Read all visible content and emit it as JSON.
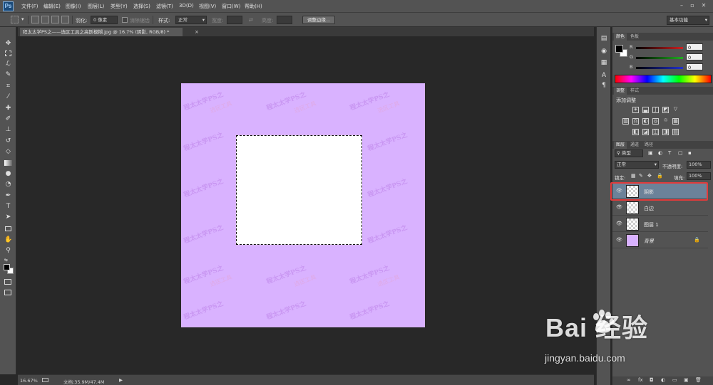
{
  "app": {
    "logo": "Ps"
  },
  "menu": [
    "文件(F)",
    "编辑(E)",
    "图像(I)",
    "图层(L)",
    "类型(Y)",
    "选择(S)",
    "滤镜(T)",
    "3D(D)",
    "视图(V)",
    "窗口(W)",
    "帮助(H)"
  ],
  "options": {
    "feather_label": "羽化:",
    "feather_value": "0 像素",
    "antialias_label": "消除锯齿",
    "style_label": "样式:",
    "style_value": "正常",
    "width_label": "宽度:",
    "height_label": "高度:",
    "refine_button": "调整边缘...",
    "workspace": "基本功能"
  },
  "document": {
    "tab_title": "程太太学PS之——选区工具之高斯模糊.jpg @ 16.7% (阴影, RGB/8) *",
    "tab_close": "×",
    "watermark_text_1": "程太太学PS之",
    "watermark_text_2": "选区工具"
  },
  "status": {
    "zoom": "16.67%",
    "doc_info": "文档:35.9M/47.4M"
  },
  "color_panel": {
    "tabs": [
      "颜色",
      "色板"
    ],
    "sliders": [
      {
        "label": "R",
        "value": "0",
        "color": "#d02020"
      },
      {
        "label": "G",
        "value": "0",
        "color": "#20b020"
      },
      {
        "label": "B",
        "value": "0",
        "color": "#2030d0"
      }
    ]
  },
  "adjust_panel": {
    "tabs": [
      "调整",
      "样式"
    ],
    "title": "添加调整"
  },
  "layers_panel": {
    "tabs": [
      "图层",
      "通道",
      "路径"
    ],
    "filter_label": "类型",
    "blend_mode": "正常",
    "opacity_label": "不透明度:",
    "opacity_value": "100%",
    "lock_label": "锁定:",
    "fill_label": "填充:",
    "fill_value": "100%",
    "layers": [
      {
        "name": "阴影",
        "selected": true
      },
      {
        "name": "白边",
        "selected": false
      },
      {
        "name": "图层 1",
        "selected": false
      },
      {
        "name": "背景",
        "selected": false
      }
    ]
  },
  "watermark": {
    "main": "Bai  经验",
    "sub": "jingyan.baidu.com"
  }
}
